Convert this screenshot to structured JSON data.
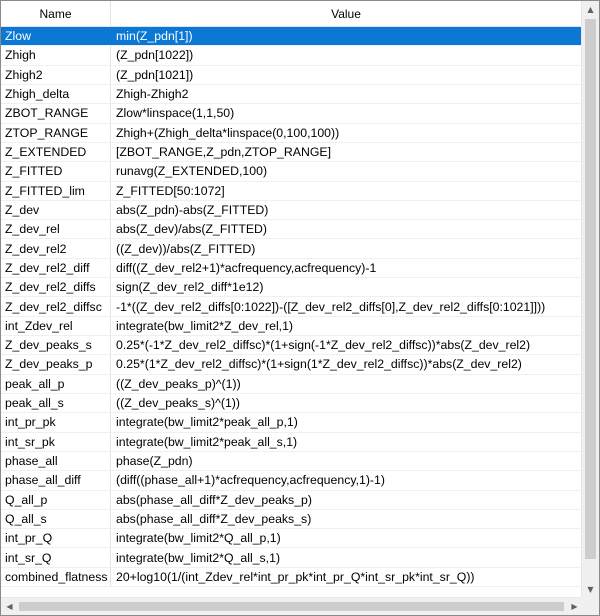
{
  "header": {
    "name_label": "Name",
    "value_label": "Value"
  },
  "colors": {
    "selection": "#0a78d4"
  },
  "selected_index": 0,
  "rows": [
    {
      "name": "Zlow",
      "value": "min(Z_pdn[1])"
    },
    {
      "name": "Zhigh",
      "value": "(Z_pdn[1022])"
    },
    {
      "name": "Zhigh2",
      "value": "(Z_pdn[1021])"
    },
    {
      "name": "Zhigh_delta",
      "value": "Zhigh-Zhigh2"
    },
    {
      "name": "ZBOT_RANGE",
      "value": "Zlow*linspace(1,1,50)"
    },
    {
      "name": "ZTOP_RANGE",
      "value": "Zhigh+(Zhigh_delta*linspace(0,100,100))"
    },
    {
      "name": "Z_EXTENDED",
      "value": "[ZBOT_RANGE,Z_pdn,ZTOP_RANGE]"
    },
    {
      "name": "Z_FITTED",
      "value": "runavg(Z_EXTENDED,100)"
    },
    {
      "name": "Z_FITTED_lim",
      "value": "Z_FITTED[50:1072]"
    },
    {
      "name": "Z_dev",
      "value": "abs(Z_pdn)-abs(Z_FITTED)"
    },
    {
      "name": "Z_dev_rel",
      "value": "abs(Z_dev)/abs(Z_FITTED)"
    },
    {
      "name": "Z_dev_rel2",
      "value": "((Z_dev))/abs(Z_FITTED)"
    },
    {
      "name": "Z_dev_rel2_diff",
      "value": "diff((Z_dev_rel2+1)*acfrequency,acfrequency)-1"
    },
    {
      "name": "Z_dev_rel2_diffs",
      "value": "sign(Z_dev_rel2_diff*1e12)"
    },
    {
      "name": "Z_dev_rel2_diffsc",
      "value": "-1*((Z_dev_rel2_diffs[0:1022])-([Z_dev_rel2_diffs[0],Z_dev_rel2_diffs[0:1021]]))"
    },
    {
      "name": "int_Zdev_rel",
      "value": "integrate(bw_limit2*Z_dev_rel,1)"
    },
    {
      "name": "Z_dev_peaks_s",
      "value": "0.25*(-1*Z_dev_rel2_diffsc)*(1+sign(-1*Z_dev_rel2_diffsc))*abs(Z_dev_rel2)"
    },
    {
      "name": "Z_dev_peaks_p",
      "value": "0.25*(1*Z_dev_rel2_diffsc)*(1+sign(1*Z_dev_rel2_diffsc))*abs(Z_dev_rel2)"
    },
    {
      "name": "peak_all_p",
      "value": "((Z_dev_peaks_p)^(1))"
    },
    {
      "name": "peak_all_s",
      "value": "((Z_dev_peaks_s)^(1))"
    },
    {
      "name": "int_pr_pk",
      "value": "integrate(bw_limit2*peak_all_p,1)"
    },
    {
      "name": "int_sr_pk",
      "value": "integrate(bw_limit2*peak_all_s,1)"
    },
    {
      "name": "phase_all",
      "value": "phase(Z_pdn)"
    },
    {
      "name": "phase_all_diff",
      "value": "(diff((phase_all+1)*acfrequency,acfrequency,1)-1)"
    },
    {
      "name": "Q_all_p",
      "value": "abs(phase_all_diff*Z_dev_peaks_p)"
    },
    {
      "name": "Q_all_s",
      "value": "abs(phase_all_diff*Z_dev_peaks_s)"
    },
    {
      "name": "int_pr_Q",
      "value": "integrate(bw_limit2*Q_all_p,1)"
    },
    {
      "name": "int_sr_Q",
      "value": "integrate(bw_limit2*Q_all_s,1)"
    },
    {
      "name": "combined_flatness",
      "value": "20+log10(1/(int_Zdev_rel*int_pr_pk*int_pr_Q*int_sr_pk*int_sr_Q))"
    }
  ],
  "scrollbar": {
    "up_icon": "arrow-up-icon",
    "down_icon": "arrow-down-icon",
    "left_icon": "arrow-left-icon",
    "right_icon": "arrow-right-icon"
  }
}
